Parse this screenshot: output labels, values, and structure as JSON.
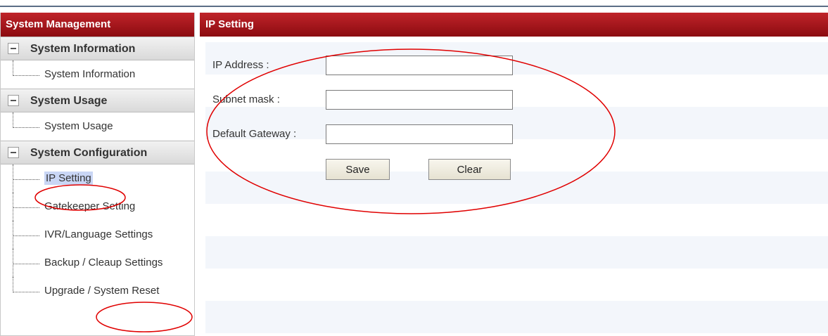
{
  "sidebar": {
    "title": "System Management",
    "groups": [
      {
        "title": "System Information",
        "items": [
          {
            "label": "System Information"
          }
        ]
      },
      {
        "title": "System Usage",
        "items": [
          {
            "label": "System Usage"
          }
        ]
      },
      {
        "title": "System Configuration",
        "items": [
          {
            "label": "IP Setting",
            "selected": true
          },
          {
            "label": "Gatekeeper Setting"
          },
          {
            "label": "IVR/Language Settings"
          },
          {
            "label": "Backup / Cleaup Settings"
          },
          {
            "label": "Upgrade / System Reset"
          }
        ]
      }
    ]
  },
  "main": {
    "title": "IP Setting",
    "form": {
      "ip_label": "IP Address :",
      "ip_value": "",
      "subnet_label": "Subnet mask :",
      "subnet_value": "",
      "gateway_label": "Default Gateway :",
      "gateway_value": "",
      "save_label": "Save",
      "clear_label": "Clear"
    }
  },
  "colors": {
    "header_red": "#a5161c",
    "annotation_red": "#e00000",
    "selection": "#c9d6f5"
  }
}
